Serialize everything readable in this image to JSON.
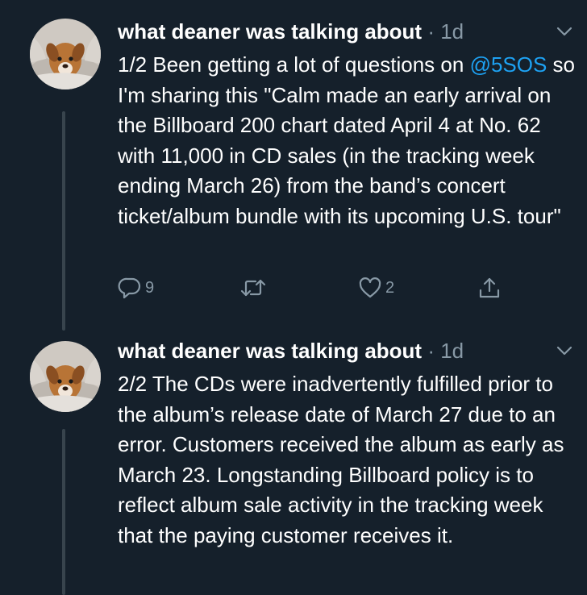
{
  "tweets": [
    {
      "author_name": "what deaner was talking about",
      "separator": "·",
      "time": "1d",
      "text_prefix": "1/2 Been getting a lot of questions on",
      "mention": "@5SOS",
      "text_suffix": " so I'm sharing this \"Calm made an early arrival on the Billboard 200 chart dated April 4 at No. 62 with 11,000 in CD sales (in the tracking week ending March 26) from the band’s concert ticket/album bundle with its upcoming U.S. tour\"",
      "reply_count": "9",
      "like_count": "2",
      "icons": [
        "chevron-down-icon",
        "reply-icon",
        "retweet-icon",
        "like-icon",
        "share-icon"
      ]
    },
    {
      "author_name": "what deaner was talking about",
      "separator": "·",
      "time": "1d",
      "text": "2/2 The CDs were inadvertently fulfilled prior to the album’s release date of March 27 due to an error. Customers received the album as early as March 23. Longstanding Billboard policy is to reflect album sale activity in the tracking week that the paying customer receives it.",
      "icons": [
        "chevron-down-icon"
      ]
    }
  ],
  "colors": {
    "background": "#15202b",
    "text": "#ffffff",
    "secondary": "#8899a6",
    "link": "#1da1f2",
    "thread_line": "#38444d"
  }
}
